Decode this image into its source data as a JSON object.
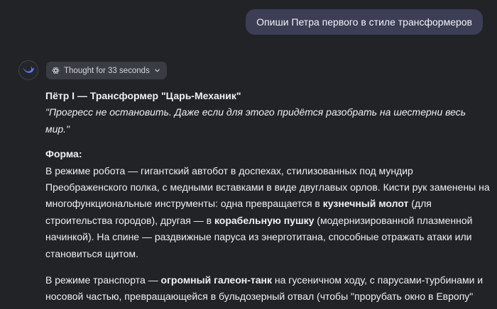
{
  "user_message": "Опиши Петра первого в стиле трансформеров",
  "assistant": {
    "avatar_icon": "whale-logo-icon",
    "thought_chip": {
      "label": "Thought for 33 seconds",
      "icon": "atom-icon",
      "chevron": "chevron-down-icon"
    },
    "title": "Пётр I — Трансформер \"Царь-Механик\"",
    "quote": "\"Прогресс не остановить. Даже если для этого придётся разобрать на шестерни весь мир.\"",
    "section_heading": "Форма:",
    "para1": {
      "t1": "В режиме робота — гигантский автобот в доспехах, стилизованных под мундир Преображенского полка, с медными вставками в виде двуглавых орлов. Кисти рук заменены на многофункциональные инструменты: одна превращается в ",
      "b1": "кузнечный молот",
      "t2": " (для строительства городов), другая — в ",
      "b2": "корабельную пушку",
      "t3": " (модернизированной плазменной начинкой). На спине — раздвижные паруса из энерготитана, способные отражать атаки или становиться щитом."
    },
    "para2": {
      "t1": "В режиме транспорта — ",
      "b1": "огромный галеон-танк",
      "t2": " на гусеничном ходу, с парусами-турбинами и носовой частью, превращающейся в бульдозерный отвал (чтобы \"прорубать окно в Европу\" буквально)."
    }
  }
}
